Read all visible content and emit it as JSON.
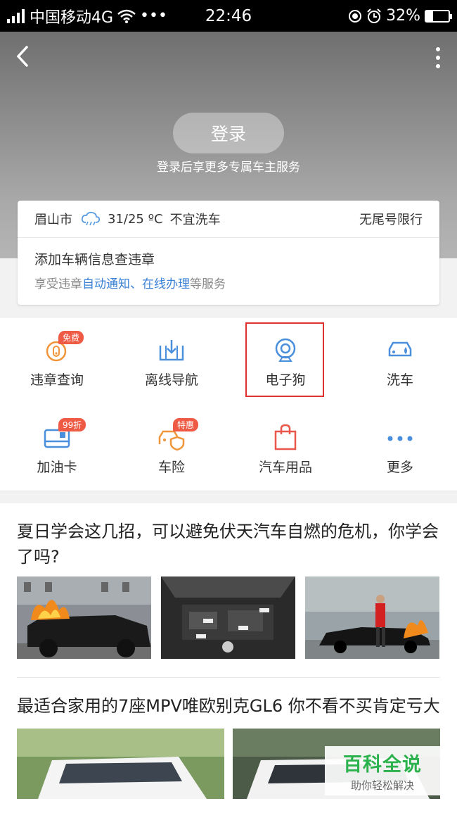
{
  "status_bar": {
    "carrier": "中国移动4G",
    "time": "22:46",
    "battery": "32%",
    "battery_level": 0.32
  },
  "header": {
    "login_label": "登录",
    "login_sub": "登录后享更多专属车主服务"
  },
  "weather": {
    "city": "眉山市",
    "temp": "31/25 ºC",
    "advice": "不宜洗车",
    "restriction": "无尾号限行"
  },
  "add_car": {
    "title": "添加车辆信息查违章",
    "sub_prefix": "享受违章",
    "sub_link": "自动通知、在线办理",
    "sub_suffix": "等服务"
  },
  "grid": {
    "items": [
      {
        "label": "违章查询",
        "icon": "violation-icon",
        "badge": "免费"
      },
      {
        "label": "离线导航",
        "icon": "offline-nav-icon",
        "badge": ""
      },
      {
        "label": "电子狗",
        "icon": "e-dog-icon",
        "badge": ""
      },
      {
        "label": "洗车",
        "icon": "car-wash-icon",
        "badge": ""
      },
      {
        "label": "加油卡",
        "icon": "fuel-card-icon",
        "badge": "99折"
      },
      {
        "label": "车险",
        "icon": "car-insurance-icon",
        "badge": "特惠"
      },
      {
        "label": "汽车用品",
        "icon": "shopping-bag-icon",
        "badge": ""
      },
      {
        "label": "更多",
        "icon": "more-icon",
        "badge": ""
      }
    ]
  },
  "feed": {
    "articles": [
      {
        "title": "夏日学会这几招，可以避免伏天汽车自燃的危机，你学会了吗?"
      },
      {
        "title": "最适合家用的7座MPV唯欧别克GL6 你不看不买肯定亏大"
      }
    ]
  },
  "watermark": {
    "line1": "百科全说",
    "line2": "助你轻松解决"
  },
  "colors": {
    "accent_blue": "#3b82d6",
    "badge_red": "#ee5a44",
    "highlight_red": "#e03030",
    "watermark_green": "#2bb24c"
  }
}
